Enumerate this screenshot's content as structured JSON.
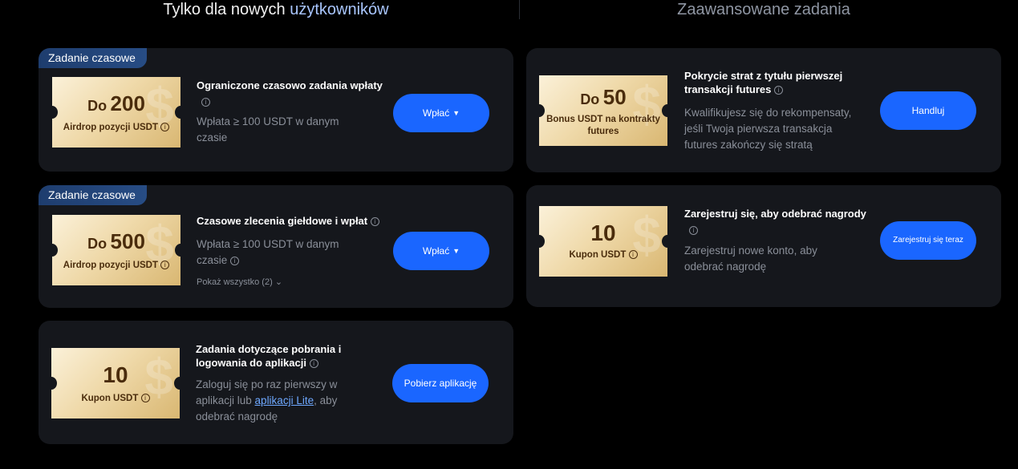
{
  "headers": {
    "left_prefix": "Tylko dla nowych ",
    "left_accent": "użytkowników",
    "right": "Zaawansowane zadania"
  },
  "left_cards": [
    {
      "badge": "Zadanie czasowe",
      "ticket_prefix": "Do",
      "ticket_amount": "200",
      "ticket_label": "Airdrop pozycji USDT",
      "title": "Ograniczone czasowo zadania wpłaty",
      "description": "Wpłata ≥ 100 USDT w danym czasie",
      "button": "Wpłać"
    },
    {
      "badge": "Zadanie czasowe",
      "ticket_prefix": "Do",
      "ticket_amount": "500",
      "ticket_label": "Airdrop pozycji USDT",
      "title": "Czasowe zlecenia giełdowe i wpłat",
      "description": "Wpłata ≥ 100 USDT w danym czasie",
      "show_all": "Pokaż wszystko (2)",
      "button": "Wpłać"
    },
    {
      "ticket_amount": "10",
      "ticket_label": "Kupon USDT",
      "title": "Zadania dotyczące pobrania i logowania do aplikacji",
      "description_before": "Zaloguj się po raz pierwszy w aplikacji lub ",
      "description_link": "aplikacji Lite",
      "description_after": ", aby odebrać nagrodę",
      "button": "Pobierz aplikację"
    }
  ],
  "right_cards": [
    {
      "ticket_prefix": "Do",
      "ticket_amount": "50",
      "ticket_label": "Bonus USDT na kontrakty futures",
      "title": "Pokrycie strat z tytułu pierwszej transakcji futures",
      "description": "Kwalifikujesz się do rekompensaty, jeśli Twoja pierwsza transakcja futures zakończy się stratą",
      "button": "Handluj"
    },
    {
      "ticket_amount": "10",
      "ticket_label": "Kupon USDT",
      "title": "Zarejestruj się, aby odebrać nagrody",
      "description": "Zarejestruj nowe konto, aby odebrać nagrodę",
      "button": "Zarejestruj się teraz"
    }
  ],
  "colors": {
    "background": "#000000",
    "card": "#15171c",
    "accent_button": "#1a66ff",
    "badge": "#274c84",
    "ticket_gold": "#efd9a9"
  },
  "icons": {
    "info": "info-circle-icon",
    "caret": "caret-down-icon",
    "chevron": "chevron-down-icon"
  }
}
